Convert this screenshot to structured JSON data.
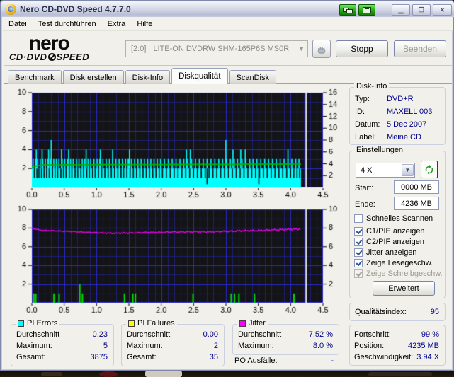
{
  "window": {
    "title": "Nero CD-DVD Speed 4.7.7.0"
  },
  "menu": {
    "items": [
      "Datei",
      "Test durchführen",
      "Extra",
      "Hilfe"
    ]
  },
  "toolbar": {
    "logo_top": "nero",
    "logo_cd": "CD·DVD",
    "logo_speed": "SPEED",
    "drive_bus": "[2:0]",
    "drive_name": "LITE-ON DVDRW SHM-165P6S MS0R",
    "stop": "Stopp",
    "quit": "Beenden"
  },
  "tabs": {
    "items": [
      "Benchmark",
      "Disk erstellen",
      "Disk-Info",
      "Diskqualität",
      "ScanDisk"
    ],
    "active": "Diskqualität"
  },
  "disk_info": {
    "title": "Disk-Info",
    "rows": [
      [
        "Typ:",
        "DVD+R"
      ],
      [
        "ID:",
        "MAXELL 003"
      ],
      [
        "Datum:",
        "5 Dec 2007"
      ],
      [
        "Label:",
        "Meine CD"
      ]
    ]
  },
  "settings": {
    "title": "Einstellungen",
    "speed": "4 X",
    "start_label": "Start:",
    "start_value": "0000 MB",
    "end_label": "Ende:",
    "end_value": "4236 MB",
    "advanced": "Erweitert",
    "checkboxes": [
      {
        "label": "Schnelles Scannen",
        "checked": false,
        "enabled": true
      },
      {
        "label": "C1/PIE anzeigen",
        "checked": true,
        "enabled": true
      },
      {
        "label": "C2/PIF anzeigen",
        "checked": true,
        "enabled": true
      },
      {
        "label": "Jitter anzeigen",
        "checked": true,
        "enabled": true
      },
      {
        "label": "Zeige Lesegeschw.",
        "checked": true,
        "enabled": true
      },
      {
        "label": "Zeige Schreibgeschw.",
        "checked": true,
        "enabled": false
      }
    ]
  },
  "quality": {
    "label": "Qualitätsindex:",
    "value": "95"
  },
  "progress": {
    "rows": [
      [
        "Fortschritt:",
        "99 %"
      ],
      [
        "Position:",
        "4235 MB"
      ],
      [
        "Geschwindigkeit:",
        "3.94 X"
      ]
    ]
  },
  "stats": {
    "pi_errors": {
      "title": "PI Errors",
      "swatch": "#00ffff",
      "rows": [
        [
          "Durchschnitt",
          "0.23"
        ],
        [
          "Maximum:",
          "5"
        ],
        [
          "Gesamt:",
          "3875"
        ]
      ]
    },
    "pi_failures": {
      "title": "PI Failures",
      "swatch": "#ffff00",
      "rows": [
        [
          "Durchschnitt",
          "0.00"
        ],
        [
          "Maximum:",
          "2"
        ],
        [
          "Gesamt:",
          "35"
        ]
      ]
    },
    "jitter": {
      "title": "Jitter",
      "swatch": "#ff00ff",
      "rows": [
        [
          "Durchschnitt",
          "7.52 %"
        ],
        [
          "Maximum:",
          "8.0 %"
        ]
      ]
    },
    "po_failures": {
      "label": "PO Ausfälle:",
      "value": "-"
    }
  },
  "chart_data": [
    {
      "type": "bar",
      "name": "pi-errors-scan",
      "xlim": [
        0,
        4.5
      ],
      "xticks": [
        "0.0",
        "0.5",
        "1.0",
        "1.5",
        "2.0",
        "2.5",
        "3.0",
        "3.5",
        "4.0",
        "4.5"
      ],
      "left_axis": {
        "lim": [
          0,
          10
        ],
        "ticks": [
          2,
          4,
          6,
          8,
          10
        ]
      },
      "right_axis": {
        "lim": [
          0,
          16
        ],
        "ticks": [
          2,
          4,
          6,
          8,
          10,
          12,
          14,
          16
        ]
      },
      "scan_end": 4.16,
      "position_line": 4.24,
      "colors": {
        "bg": "#141414",
        "grid_minor": "#1e1e78",
        "grid_major": "#2828cc",
        "position": "#e6e6e6"
      },
      "bars": {
        "color": "#00ffff",
        "base": 2,
        "dip0": [
          2.7,
          3.5
        ],
        "dip1": [
          0.03,
          0.07,
          0.1,
          0.14,
          0.18,
          0.22,
          0.26,
          0.31,
          0.35,
          0.39,
          0.44,
          0.48,
          0.52,
          0.57,
          0.61,
          0.66,
          0.7,
          0.75,
          0.79,
          0.84,
          0.88,
          0.93,
          0.97,
          1.02,
          1.07,
          1.12,
          1.17,
          1.22,
          1.27,
          1.32,
          1.37,
          1.41,
          1.46,
          1.51,
          1.56,
          1.61,
          1.66,
          1.71,
          1.76,
          1.81,
          1.86,
          1.91,
          1.96,
          2.01,
          2.07,
          2.13,
          2.19,
          2.25,
          2.31,
          2.37,
          2.43,
          2.49,
          2.55,
          2.61,
          2.67,
          2.73,
          2.79,
          2.85,
          2.91,
          2.97,
          3.03,
          3.09,
          3.15,
          3.21,
          3.27,
          3.33,
          3.39,
          3.45,
          3.51,
          3.57,
          3.63,
          3.69,
          3.75,
          3.81,
          3.87,
          3.93,
          3.99,
          4.04,
          4.09,
          4.13
        ],
        "spike3": [
          0.01,
          0.05,
          0.08,
          0.12,
          0.16,
          0.2,
          0.24,
          0.28,
          0.33,
          0.37,
          0.41,
          0.46,
          0.5,
          0.54,
          0.59,
          0.63,
          0.68,
          0.72,
          0.77,
          0.81,
          0.86,
          0.9,
          0.95,
          1.0,
          1.04,
          1.09,
          1.14,
          1.19,
          1.24,
          1.29,
          1.34,
          1.39,
          1.44,
          1.48,
          1.49,
          1.53,
          1.58,
          1.63,
          1.68,
          1.73,
          1.78,
          1.83,
          1.88,
          1.93,
          1.98,
          2.04,
          2.1,
          2.16,
          2.22,
          2.28,
          2.34,
          2.4,
          2.46,
          2.52,
          2.58,
          2.64,
          2.7,
          2.76,
          2.82,
          2.88,
          2.94,
          3.0,
          3.06,
          3.12,
          3.17,
          3.24,
          3.3,
          3.36,
          3.41,
          3.47,
          3.53,
          3.59,
          3.65,
          3.71,
          3.77,
          3.83,
          3.89,
          3.95,
          4.01,
          4.07,
          4.12
        ],
        "spike4": [
          0.06,
          0.15,
          0.25,
          0.45,
          0.56,
          0.83,
          1.05,
          1.24,
          1.5,
          2.38,
          2.44,
          3.1,
          3.22,
          3.29,
          3.95
        ],
        "spike5": [
          0.29,
          2.99
        ]
      },
      "speed_line": {
        "color": "#00b400",
        "axis": "right",
        "points": [
          [
            0,
            3.45
          ],
          [
            0.15,
            3.8
          ],
          [
            1.0,
            3.85
          ],
          [
            3.0,
            3.9
          ],
          [
            4.16,
            3.95
          ]
        ]
      }
    },
    {
      "type": "line",
      "name": "jitter-pif-scan",
      "xlim": [
        0,
        4.5
      ],
      "xticks": [
        "0.0",
        "0.5",
        "1.0",
        "1.5",
        "2.0",
        "2.5",
        "3.0",
        "3.5",
        "4.0",
        "4.5"
      ],
      "left_axis": {
        "lim": [
          0,
          10
        ],
        "ticks": [
          2,
          4,
          6,
          8,
          10
        ]
      },
      "right_axis": {
        "lim": [
          0,
          10
        ],
        "ticks": [
          2,
          4,
          6,
          8,
          10
        ]
      },
      "scan_end": 4.16,
      "position_line": 4.24,
      "colors": {
        "bg": "#141414",
        "grid_minor": "#1e1e78",
        "grid_major": "#2828cc",
        "position": "#e6e6e6"
      },
      "jitter_line": {
        "color": "#ff00ff",
        "noise": 0.06,
        "points": [
          [
            0,
            8.0
          ],
          [
            0.15,
            7.75
          ],
          [
            0.4,
            7.7
          ],
          [
            0.7,
            7.6
          ],
          [
            1.0,
            7.5
          ],
          [
            1.3,
            7.45
          ],
          [
            1.6,
            7.5
          ],
          [
            2.0,
            7.55
          ],
          [
            2.4,
            7.6
          ],
          [
            2.8,
            7.6
          ],
          [
            3.2,
            7.7
          ],
          [
            3.6,
            7.75
          ],
          [
            3.9,
            7.85
          ],
          [
            4.16,
            7.9
          ]
        ]
      },
      "failure_bars": {
        "color": "#00dc00",
        "height1": [
          0.02,
          0.05,
          0.33,
          0.41,
          0.77,
          1.42,
          1.55,
          1.59,
          2.48,
          3.07,
          3.12,
          3.19,
          3.43,
          4.04
        ],
        "height2": [
          0.73
        ]
      }
    }
  ]
}
